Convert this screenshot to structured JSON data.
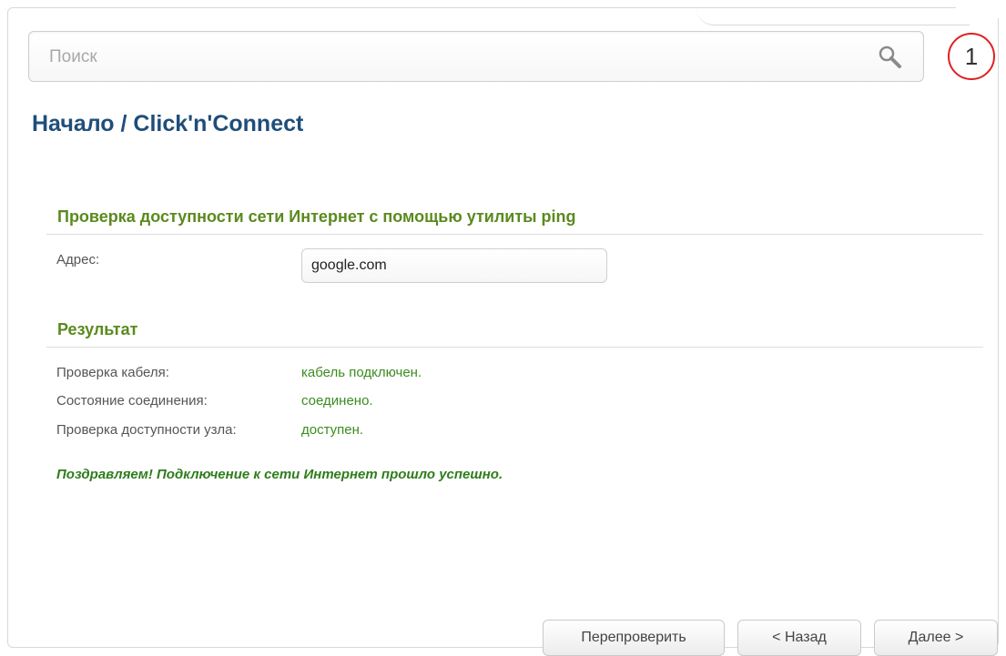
{
  "search": {
    "placeholder": "Поиск"
  },
  "badge": {
    "number": "1",
    "color": "#e02020"
  },
  "breadcrumb": {
    "home": "Начало",
    "separator": " / ",
    "page": "Click'n'Connect"
  },
  "ping_section": {
    "title": "Проверка доступности сети Интернет с помощью утилиты ping",
    "address_label": "Адрес:",
    "address_value": "google.com"
  },
  "result_section": {
    "title": "Результат",
    "rows": [
      {
        "label": "Проверка кабеля:",
        "value": "кабель подключен."
      },
      {
        "label": "Состояние соединения:",
        "value": "соединено."
      },
      {
        "label": "Проверка доступности узла:",
        "value": "доступен."
      }
    ]
  },
  "success_message": "Поздравляем! Подключение к сети Интернет прошло успешно.",
  "buttons": {
    "recheck": "Перепроверить",
    "back": "< Назад",
    "next": "Далее >"
  },
  "colors": {
    "heading": "#1f4e79",
    "section": "#5a8a1e",
    "status_ok": "#3b8c1f"
  }
}
